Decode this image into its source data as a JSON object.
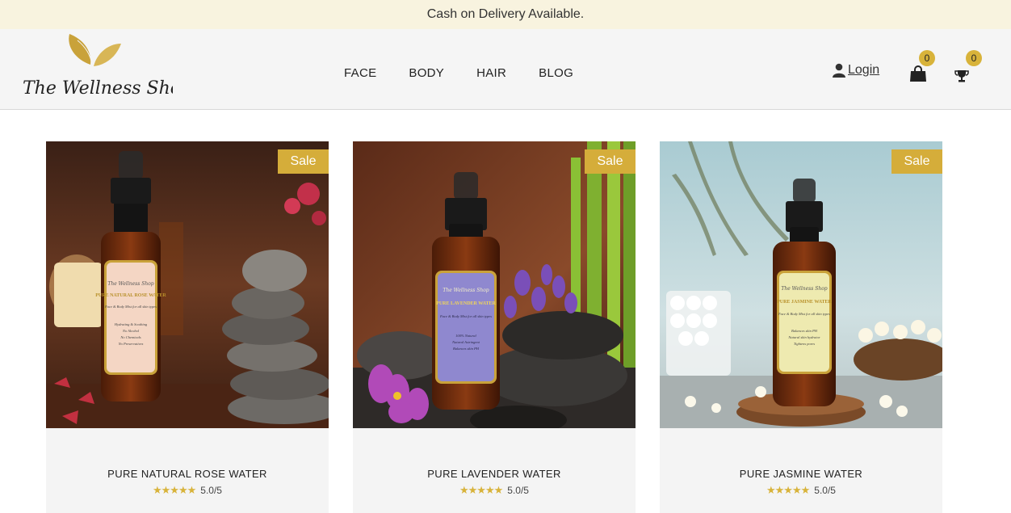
{
  "announcement": "Cash on Delivery Available.",
  "logo": {
    "text": "The Wellness Shop",
    "color": "#c9a23a"
  },
  "nav": [
    "FACE",
    "BODY",
    "HAIR",
    "BLOG"
  ],
  "account": {
    "login_label": "Login",
    "cart_count": "0",
    "rewards_count": "0"
  },
  "colors": {
    "accent": "#d5ad3a",
    "announcement_bg": "#f8f3df",
    "header_bg": "#f5f5f5",
    "card_bg": "#f4f4f4"
  },
  "products": [
    {
      "name": "PURE NATURAL ROSE WATER",
      "badge": "Sale",
      "rating_stars": "★★★★★",
      "rating_text": "5.0/5",
      "label": {
        "brand": "The Wellness Shop",
        "title": "PURE NATURAL ROSE WATER",
        "sub": "Face & Body Mist for all skin types",
        "features": [
          "Hydrating & Soothing",
          "No Alcohol",
          "No Chemicals",
          "No Preservatives"
        ],
        "color": "#f4d6c4"
      }
    },
    {
      "name": "PURE LAVENDER WATER",
      "badge": "Sale",
      "rating_stars": "★★★★★",
      "rating_text": "5.0/5",
      "label": {
        "brand": "The Wellness Shop",
        "title": "PURE LAVENDER WATER",
        "sub": "Face & Body Mist for all skin types",
        "features": [
          "100% Natural",
          "Natural Astringent",
          "Balances skin PH"
        ],
        "color": "#8f88cf"
      }
    },
    {
      "name": "PURE JASMINE WATER",
      "badge": "Sale",
      "rating_stars": "★★★★★",
      "rating_text": "5.0/5",
      "label": {
        "brand": "The Wellness Shop",
        "title": "PURE JASMINE WATER",
        "sub": "Face & Body Mist for all skin types",
        "features": [
          "Balances skin PH",
          "Natural skin hydrator",
          "Tightens pores"
        ],
        "color": "#eeeab0"
      }
    }
  ]
}
